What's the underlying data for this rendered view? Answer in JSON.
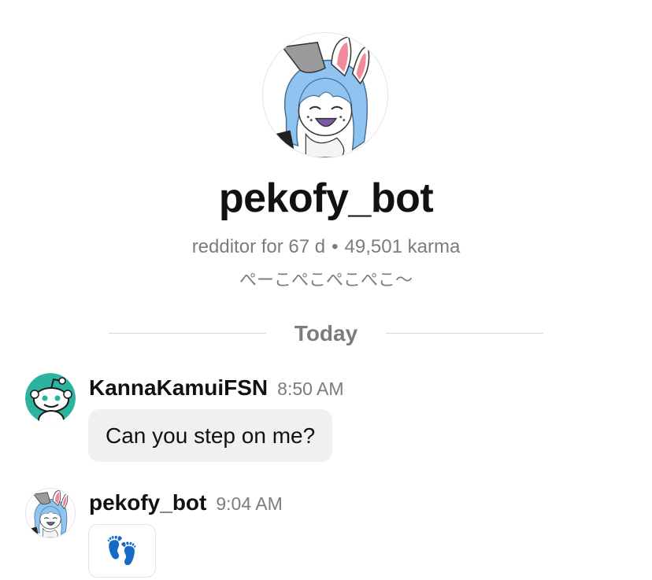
{
  "profile": {
    "username": "pekofy_bot",
    "stats_age": "redditor for 67 d",
    "stats_separator": "•",
    "stats_karma": "49,501 karma",
    "bio": "ぺーこぺこぺこぺこ～"
  },
  "divider": {
    "label": "Today"
  },
  "messages": [
    {
      "author": "KannaKamuiFSN",
      "time": "8:50 AM",
      "text": "Can you step on me?",
      "avatar_icon": "snoo-avatar-icon"
    },
    {
      "author": "pekofy_bot",
      "time": "9:04 AM",
      "text": "👣",
      "avatar_icon": "anime-bunny-avatar-icon"
    }
  ],
  "colors": {
    "avatar_teal": "#2bb3a0",
    "bubble_bg": "#f0f0f2",
    "muted_text": "#7c7c7c",
    "hair_blue": "#8fc3f0",
    "ear_pink": "#f08a9a"
  }
}
